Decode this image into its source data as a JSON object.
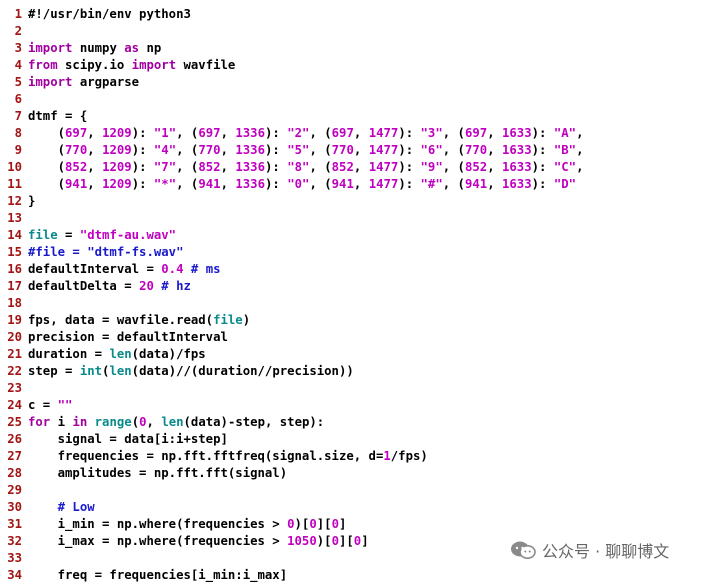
{
  "editor": {
    "lines": [
      [
        [
          "pl",
          "#!/usr/bin/env python3"
        ]
      ],
      [],
      [
        [
          "kw",
          "import"
        ],
        [
          "pl",
          " numpy "
        ],
        [
          "kw",
          "as"
        ],
        [
          "pl",
          " np"
        ]
      ],
      [
        [
          "kw",
          "from"
        ],
        [
          "pl",
          " scipy.io "
        ],
        [
          "kw",
          "import"
        ],
        [
          "pl",
          " wavfile"
        ]
      ],
      [
        [
          "kw",
          "import"
        ],
        [
          "pl",
          " argparse"
        ]
      ],
      [],
      [
        [
          "pl",
          "dtmf = {"
        ]
      ],
      [
        [
          "pl",
          "    ("
        ],
        [
          "num",
          "697"
        ],
        [
          "pl",
          ", "
        ],
        [
          "num",
          "1209"
        ],
        [
          "pl",
          "): "
        ],
        [
          "str",
          "\"1\""
        ],
        [
          "pl",
          ", ("
        ],
        [
          "num",
          "697"
        ],
        [
          "pl",
          ", "
        ],
        [
          "num",
          "1336"
        ],
        [
          "pl",
          "): "
        ],
        [
          "str",
          "\"2\""
        ],
        [
          "pl",
          ", ("
        ],
        [
          "num",
          "697"
        ],
        [
          "pl",
          ", "
        ],
        [
          "num",
          "1477"
        ],
        [
          "pl",
          "): "
        ],
        [
          "str",
          "\"3\""
        ],
        [
          "pl",
          ", ("
        ],
        [
          "num",
          "697"
        ],
        [
          "pl",
          ", "
        ],
        [
          "num",
          "1633"
        ],
        [
          "pl",
          "): "
        ],
        [
          "str",
          "\"A\""
        ],
        [
          "pl",
          ","
        ]
      ],
      [
        [
          "pl",
          "    ("
        ],
        [
          "num",
          "770"
        ],
        [
          "pl",
          ", "
        ],
        [
          "num",
          "1209"
        ],
        [
          "pl",
          "): "
        ],
        [
          "str",
          "\"4\""
        ],
        [
          "pl",
          ", ("
        ],
        [
          "num",
          "770"
        ],
        [
          "pl",
          ", "
        ],
        [
          "num",
          "1336"
        ],
        [
          "pl",
          "): "
        ],
        [
          "str",
          "\"5\""
        ],
        [
          "pl",
          ", ("
        ],
        [
          "num",
          "770"
        ],
        [
          "pl",
          ", "
        ],
        [
          "num",
          "1477"
        ],
        [
          "pl",
          "): "
        ],
        [
          "str",
          "\"6\""
        ],
        [
          "pl",
          ", ("
        ],
        [
          "num",
          "770"
        ],
        [
          "pl",
          ", "
        ],
        [
          "num",
          "1633"
        ],
        [
          "pl",
          "): "
        ],
        [
          "str",
          "\"B\""
        ],
        [
          "pl",
          ","
        ]
      ],
      [
        [
          "pl",
          "    ("
        ],
        [
          "num",
          "852"
        ],
        [
          "pl",
          ", "
        ],
        [
          "num",
          "1209"
        ],
        [
          "pl",
          "): "
        ],
        [
          "str",
          "\"7\""
        ],
        [
          "pl",
          ", ("
        ],
        [
          "num",
          "852"
        ],
        [
          "pl",
          ", "
        ],
        [
          "num",
          "1336"
        ],
        [
          "pl",
          "): "
        ],
        [
          "str",
          "\"8\""
        ],
        [
          "pl",
          ", ("
        ],
        [
          "num",
          "852"
        ],
        [
          "pl",
          ", "
        ],
        [
          "num",
          "1477"
        ],
        [
          "pl",
          "): "
        ],
        [
          "str",
          "\"9\""
        ],
        [
          "pl",
          ", ("
        ],
        [
          "num",
          "852"
        ],
        [
          "pl",
          ", "
        ],
        [
          "num",
          "1633"
        ],
        [
          "pl",
          "): "
        ],
        [
          "str",
          "\"C\""
        ],
        [
          "pl",
          ","
        ]
      ],
      [
        [
          "pl",
          "    ("
        ],
        [
          "num",
          "941"
        ],
        [
          "pl",
          ", "
        ],
        [
          "num",
          "1209"
        ],
        [
          "pl",
          "): "
        ],
        [
          "str",
          "\"*\""
        ],
        [
          "pl",
          ", ("
        ],
        [
          "num",
          "941"
        ],
        [
          "pl",
          ", "
        ],
        [
          "num",
          "1336"
        ],
        [
          "pl",
          "): "
        ],
        [
          "str",
          "\"0\""
        ],
        [
          "pl",
          ", ("
        ],
        [
          "num",
          "941"
        ],
        [
          "pl",
          ", "
        ],
        [
          "num",
          "1477"
        ],
        [
          "pl",
          "): "
        ],
        [
          "str",
          "\"#\""
        ],
        [
          "pl",
          ", ("
        ],
        [
          "num",
          "941"
        ],
        [
          "pl",
          ", "
        ],
        [
          "num",
          "1633"
        ],
        [
          "pl",
          "): "
        ],
        [
          "str",
          "\"D\""
        ]
      ],
      [
        [
          "pl",
          "}"
        ]
      ],
      [],
      [
        [
          "sb",
          "file"
        ],
        [
          "pl",
          " = "
        ],
        [
          "str",
          "\"dtmf-au.wav\""
        ]
      ],
      [
        [
          "cm",
          "#file = \"dtmf-fs.wav\""
        ]
      ],
      [
        [
          "pl",
          "defaultInterval = "
        ],
        [
          "num",
          "0.4"
        ],
        [
          "pl",
          " "
        ],
        [
          "cm",
          "# ms"
        ]
      ],
      [
        [
          "pl",
          "defaultDelta = "
        ],
        [
          "num",
          "20"
        ],
        [
          "pl",
          " "
        ],
        [
          "cm",
          "# hz"
        ]
      ],
      [],
      [
        [
          "pl",
          "fps, data = wavfile.read("
        ],
        [
          "sb",
          "file"
        ],
        [
          "pl",
          ")"
        ]
      ],
      [
        [
          "pl",
          "precision = defaultInterval"
        ]
      ],
      [
        [
          "pl",
          "duration = "
        ],
        [
          "bi",
          "len"
        ],
        [
          "pl",
          "(data)/fps"
        ]
      ],
      [
        [
          "pl",
          "step = "
        ],
        [
          "bi",
          "int"
        ],
        [
          "pl",
          "("
        ],
        [
          "bi",
          "len"
        ],
        [
          "pl",
          "(data)//(duration//precision))"
        ]
      ],
      [],
      [
        [
          "pl",
          "c = "
        ],
        [
          "str",
          "\"\""
        ]
      ],
      [
        [
          "kw",
          "for"
        ],
        [
          "pl",
          " i "
        ],
        [
          "kw",
          "in"
        ],
        [
          "pl",
          " "
        ],
        [
          "bi",
          "range"
        ],
        [
          "pl",
          "("
        ],
        [
          "num",
          "0"
        ],
        [
          "pl",
          ", "
        ],
        [
          "bi",
          "len"
        ],
        [
          "pl",
          "(data)-step, step):"
        ]
      ],
      [
        [
          "pl",
          "    signal = data[i:i+step]"
        ]
      ],
      [
        [
          "pl",
          "    frequencies = np.fft.fftfreq(signal.size, d="
        ],
        [
          "num",
          "1"
        ],
        [
          "pl",
          "/fps)"
        ]
      ],
      [
        [
          "pl",
          "    amplitudes = np.fft.fft(signal)"
        ]
      ],
      [],
      [
        [
          "pl",
          "    "
        ],
        [
          "cm",
          "# Low"
        ]
      ],
      [
        [
          "pl",
          "    i_min = np.where(frequencies > "
        ],
        [
          "num",
          "0"
        ],
        [
          "pl",
          ")["
        ],
        [
          "num",
          "0"
        ],
        [
          "pl",
          "]["
        ],
        [
          "num",
          "0"
        ],
        [
          "pl",
          "]"
        ]
      ],
      [
        [
          "pl",
          "    i_max = np.where(frequencies > "
        ],
        [
          "num",
          "1050"
        ],
        [
          "pl",
          ")["
        ],
        [
          "num",
          "0"
        ],
        [
          "pl",
          "]["
        ],
        [
          "num",
          "0"
        ],
        [
          "pl",
          "]"
        ]
      ],
      [],
      [
        [
          "pl",
          "    freq = frequencies[i_min:i_max]"
        ]
      ]
    ]
  },
  "watermark": {
    "text": "公众号 · 聊聊博文",
    "icon": "wechat-icon"
  },
  "colors": {
    "line_number": "#a31515",
    "keyword": "#a000a0",
    "builtin": "#0a8a8a",
    "string": "#c000c0",
    "comment": "#1a1acc"
  }
}
